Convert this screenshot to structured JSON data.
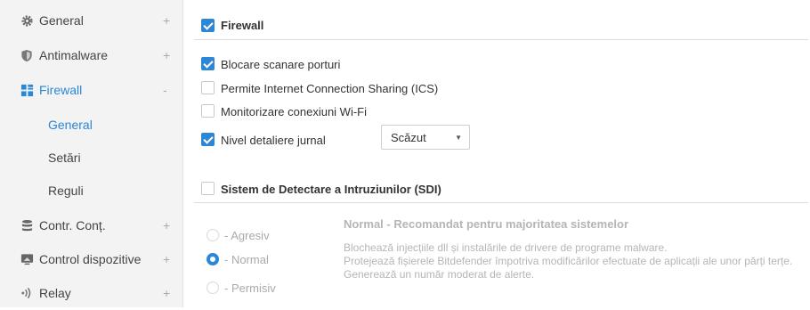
{
  "sidebar": {
    "items": [
      {
        "label": "General",
        "toggle": "+",
        "icon": "gear-icon"
      },
      {
        "label": "Antimalware",
        "toggle": "+",
        "icon": "shield-icon"
      },
      {
        "label": "Firewall",
        "toggle": "-",
        "icon": "firewall-icon"
      },
      {
        "label": "Contr. Conț.",
        "toggle": "+",
        "icon": "database-icon"
      },
      {
        "label": "Control dispozitive",
        "toggle": "+",
        "icon": "device-icon"
      },
      {
        "label": "Relay",
        "toggle": "+",
        "icon": "relay-icon"
      }
    ],
    "sub_items": [
      {
        "label": "General"
      },
      {
        "label": "Setări"
      },
      {
        "label": "Reguli"
      }
    ],
    "accent_color": "#2a86d6"
  },
  "main": {
    "firewall": {
      "label": "Firewall",
      "checked": true
    },
    "options": [
      {
        "label": "Blocare scanare porturi",
        "checked": true
      },
      {
        "label": "Permite Internet Connection Sharing (ICS)",
        "checked": false
      },
      {
        "label": "Monitorizare conexiuni Wi-Fi",
        "checked": false
      },
      {
        "label": "Nivel detaliere jurnal",
        "checked": true
      }
    ],
    "log_level": {
      "value": "Scăzut"
    },
    "ids": {
      "label": "Sistem de Detectare a Intruziunilor (SDI)",
      "checked": false
    },
    "levels": [
      {
        "label": "- Agresiv",
        "selected": false
      },
      {
        "label": "- Normal",
        "selected": true
      },
      {
        "label": "- Permisiv",
        "selected": false
      }
    ],
    "level_title": "Normal - Recomandat pentru majoritatea sistemelor",
    "level_description": [
      "Blochează injecțiile dll și instalările de drivere de programe malware.",
      "Protejează fișierele Bitdefender împotriva modificărilor efectuate de aplicații ale unor părți terțe.",
      "Generează un număr moderat de alerte."
    ]
  }
}
